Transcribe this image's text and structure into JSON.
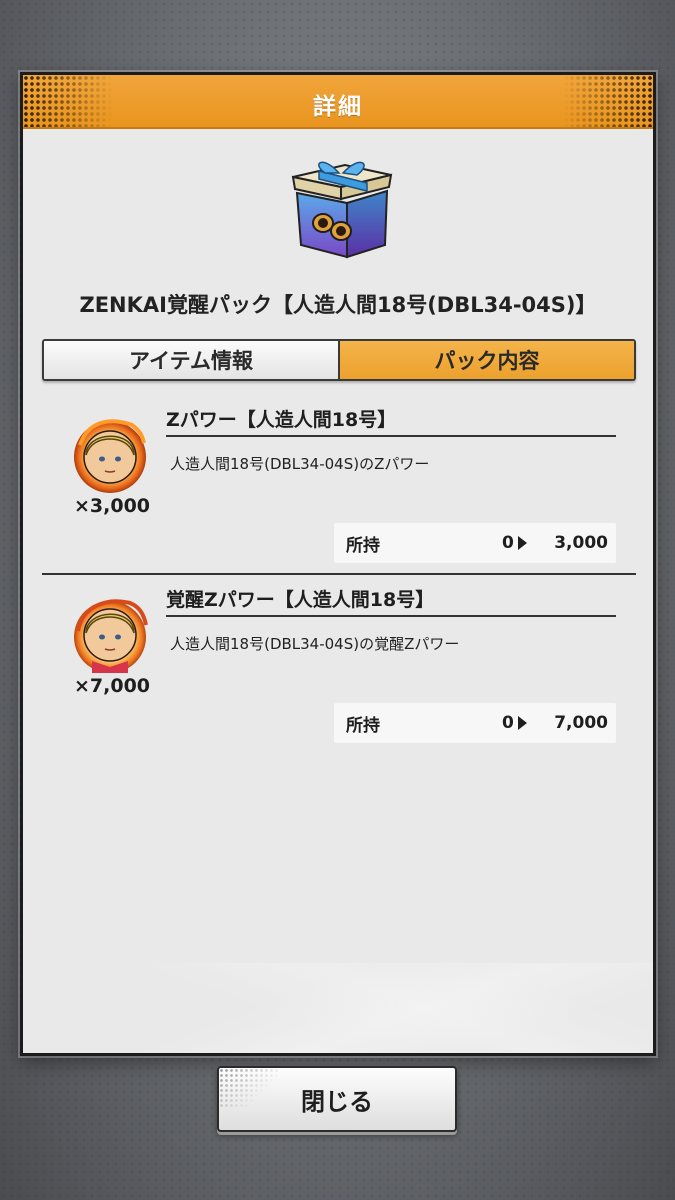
{
  "dialog": {
    "title": "詳細",
    "item_name": "ZENKAI覚醒パック【人造人間18号(DBL34-04S)】"
  },
  "tabs": [
    {
      "label": "アイテム情報",
      "active": false
    },
    {
      "label": "パック内容",
      "active": true
    }
  ],
  "rewards": [
    {
      "title": "Zパワー【人造人間18号】",
      "description": "人造人間18号(DBL34-04S)のZパワー",
      "quantity": "×3,000",
      "owned_label": "所持",
      "owned_from": "0",
      "owned_to": "3,000"
    },
    {
      "title": "覚醒Zパワー【人造人間18号】",
      "description": "人造人間18号(DBL34-04S)の覚醒Zパワー",
      "quantity": "×7,000",
      "owned_label": "所持",
      "owned_from": "0",
      "owned_to": "7,000"
    }
  ],
  "close_button": {
    "label": "閉じる"
  },
  "colors": {
    "header_orange": "#eb9b28",
    "active_tab": "#eca12d",
    "dialog_bg": "#e9e9e9"
  }
}
